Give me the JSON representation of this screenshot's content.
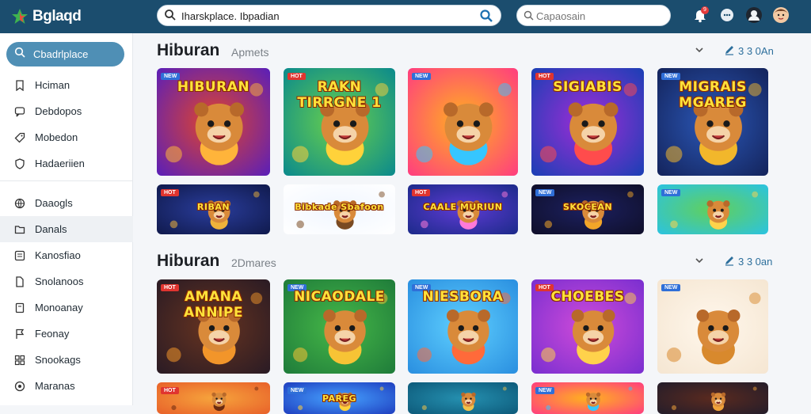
{
  "topbar": {
    "logo_text": "Bglaqd",
    "search_value": "Iharskplace. Ibpadian",
    "side_search_placeholder": "Capaosain"
  },
  "sidebar": {
    "search_label": "Cbadrlplace",
    "items_group1": [
      {
        "label": "Hciman",
        "icon": "bookmark-icon"
      },
      {
        "label": "Debdopos",
        "icon": "chat-icon"
      },
      {
        "label": "Mobedon",
        "icon": "tag-icon"
      },
      {
        "label": "Hadaeriien",
        "icon": "shield-icon"
      }
    ],
    "items_group2": [
      {
        "label": "Daaogls",
        "icon": "globe-icon",
        "active": false
      },
      {
        "label": "Danals",
        "icon": "folder-icon",
        "active": true
      },
      {
        "label": "Kanosfiao",
        "icon": "list-icon",
        "active": false
      },
      {
        "label": "Snolanoos",
        "icon": "doc-icon",
        "active": false
      },
      {
        "label": "Monoanay",
        "icon": "file-icon",
        "active": false
      },
      {
        "label": "Feonay",
        "icon": "flag-icon",
        "active": false
      },
      {
        "label": "Snookags",
        "icon": "grid-icon",
        "active": false
      },
      {
        "label": "Maranas",
        "icon": "circle-icon",
        "active": false
      }
    ]
  },
  "sections": [
    {
      "title": "Hiburan",
      "subtitle": "Apmets",
      "link": "3 3 0An",
      "cards_large": [
        {
          "title": "HIBURAN",
          "tag": "NEW",
          "theme": "purple-orange"
        },
        {
          "title": "RAKN TIRRGNE 1",
          "tag": "HOT",
          "theme": "teal-green"
        },
        {
          "title": "",
          "tag": "NEW",
          "theme": "rainbow"
        },
        {
          "title": "SIGIABIS",
          "tag": "HOT",
          "theme": "blue-purple"
        },
        {
          "title": "MIGRAIS MGAREG",
          "tag": "NEW",
          "theme": "navy-gold"
        }
      ],
      "cards_small": [
        {
          "title": "RIBAN",
          "tag": "HOT",
          "theme": "navy"
        },
        {
          "title": "Bibkade Sbafoon",
          "tag": "",
          "theme": "white"
        },
        {
          "title": "CAALE MURIUN",
          "tag": "HOT",
          "theme": "indigo"
        },
        {
          "title": "SKOCEAN",
          "tag": "NEW",
          "theme": "dark-gold"
        },
        {
          "title": "",
          "tag": "NEW",
          "theme": "cyan-green"
        }
      ]
    },
    {
      "title": "Hiburan",
      "subtitle": "2Dmares",
      "link": "3 3 0an",
      "cards_large": [
        {
          "title": "AMANA ANNIPE",
          "tag": "HOT",
          "theme": "dark-orange"
        },
        {
          "title": "NICAODALE",
          "tag": "NEW",
          "theme": "green"
        },
        {
          "title": "NIESBORA",
          "tag": "NEW",
          "theme": "skyblue"
        },
        {
          "title": "CHOEBES",
          "tag": "HOT",
          "theme": "purple"
        },
        {
          "title": "",
          "tag": "NEW",
          "theme": "cream"
        }
      ],
      "cards_small": [
        {
          "title": "",
          "tag": "HOT",
          "theme": "orange"
        },
        {
          "title": "PAREG",
          "tag": "NEW",
          "theme": "blue"
        },
        {
          "title": "",
          "tag": "",
          "theme": "teal"
        },
        {
          "title": "",
          "tag": "NEW",
          "theme": "rainbow"
        },
        {
          "title": "",
          "tag": "",
          "theme": "dark"
        }
      ]
    }
  ],
  "colors": {
    "topbar": "#1b4d6e",
    "accent": "#4f8fb5",
    "link": "#2d6f9c"
  }
}
